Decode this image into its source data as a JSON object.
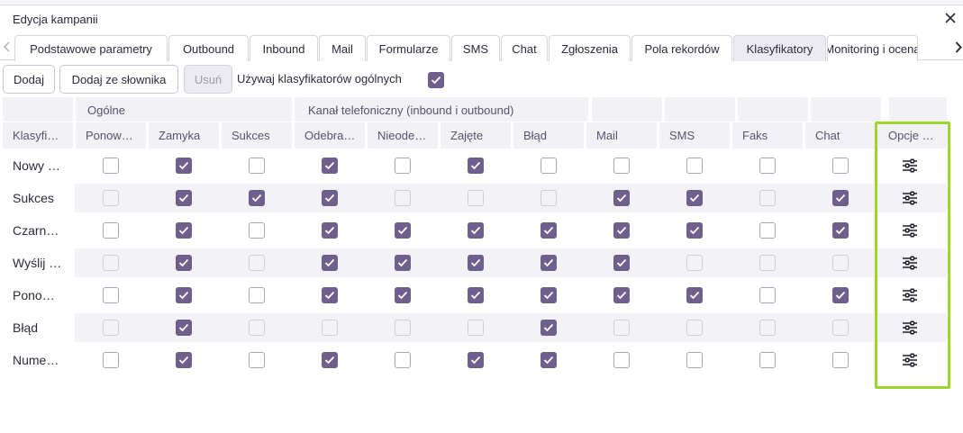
{
  "window": {
    "title": "Edycja kampanii"
  },
  "tabs": [
    "Podstawowe parametry",
    "Outbound",
    "Inbound",
    "Mail",
    "Formularze",
    "SMS",
    "Chat",
    "Zgłoszenia",
    "Pola rekordów",
    "Klasyfikatory",
    "Monitoring i ocena"
  ],
  "active_tab": "Klasyfikatory",
  "toolbar": {
    "add": "Dodaj",
    "add_from_dictionary": "Dodaj ze słownika",
    "remove": "Usuń",
    "use_general_label": "Używaj klasyfikatorów ogólnych",
    "use_general_checked": true
  },
  "groups": {
    "general": "Ogólne",
    "phone": "Kanał telefoniczny (inbound i outbound)"
  },
  "columns": [
    "Klasyfi…",
    "Ponow…",
    "Zamyka",
    "Sukces",
    "Odebra…",
    "Nieode…",
    "Zajęte",
    "Błąd",
    "Mail",
    "SMS",
    "Faks",
    "Chat",
    "Opcje …"
  ],
  "checkbox_legend": {
    "c": "checked",
    "u": "unchecked",
    "d": "disabled"
  },
  "rows": [
    {
      "label": "Nowy …",
      "cells": [
        "u",
        "c",
        "u",
        "c",
        "u",
        "c",
        "u",
        "u",
        "u",
        "u",
        "u"
      ]
    },
    {
      "label": "Sukces",
      "cells": [
        "d",
        "c",
        "c",
        "c",
        "d",
        "d",
        "d",
        "c",
        "c",
        "d",
        "c"
      ]
    },
    {
      "label": "Czarn…",
      "cells": [
        "u",
        "c",
        "u",
        "c",
        "c",
        "c",
        "c",
        "c",
        "c",
        "u",
        "c"
      ]
    },
    {
      "label": "Wyślij …",
      "cells": [
        "d",
        "c",
        "d",
        "c",
        "c",
        "c",
        "c",
        "c",
        "d",
        "d",
        "d"
      ]
    },
    {
      "label": "Pono…",
      "cells": [
        "u",
        "c",
        "u",
        "c",
        "c",
        "c",
        "c",
        "c",
        "c",
        "u",
        "c"
      ]
    },
    {
      "label": "Błąd",
      "cells": [
        "d",
        "c",
        "d",
        "d",
        "d",
        "d",
        "c",
        "d",
        "d",
        "d",
        "d"
      ]
    },
    {
      "label": "Nume…",
      "cells": [
        "u",
        "c",
        "u",
        "c",
        "u",
        "c",
        "c",
        "u",
        "u",
        "u",
        "u"
      ]
    }
  ],
  "options_icon": "sliders-icon",
  "colors": {
    "accent": "#6f5f8c",
    "highlight": "#9dd62a",
    "header_bg": "#f2f1f6"
  }
}
